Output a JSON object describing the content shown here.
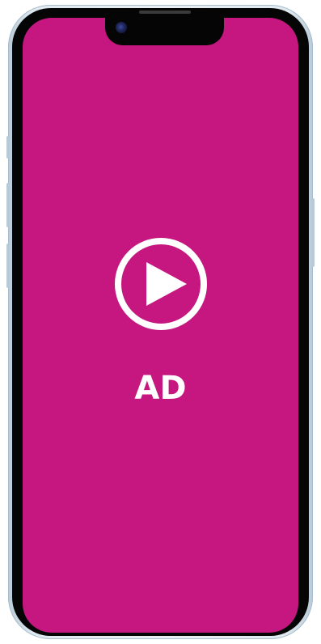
{
  "device": {
    "frame_color": "#e3ecf2",
    "bezel_color": "#050505"
  },
  "screen": {
    "background_color": "#c5177f",
    "play_icon": "play-circle-icon",
    "ad_label": "AD"
  }
}
